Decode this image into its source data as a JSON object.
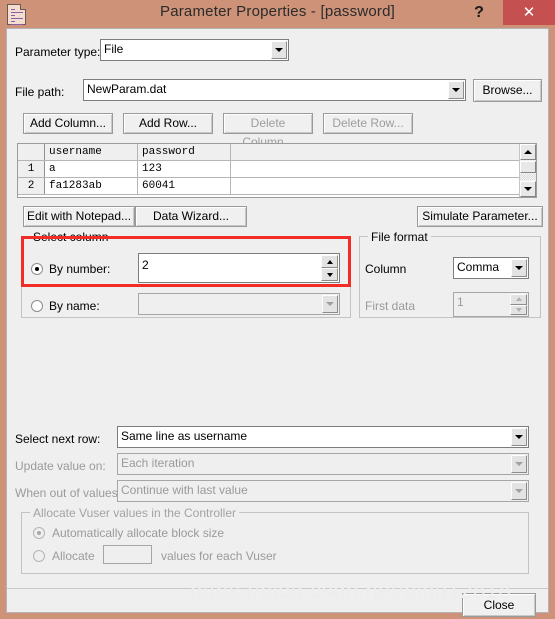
{
  "window": {
    "title": "Parameter Properties - [password]",
    "icon": "parameter-list-icon",
    "help_label": "?",
    "close_label": "✕",
    "titlebar_color": "#cd9277",
    "close_color": "#c4514f",
    "highlight_color": "#f22c26"
  },
  "parameter_type": {
    "label": "Parameter type:",
    "value": "File"
  },
  "file_path": {
    "label": "File path:",
    "value": "NewParam.dat",
    "browse_label": "Browse..."
  },
  "table_buttons": {
    "add_column": "Add Column...",
    "add_row": "Add Row...",
    "delete_column": "Delete Column...",
    "delete_row": "Delete Row..."
  },
  "grid": {
    "columns": [
      "",
      "username",
      "password",
      ""
    ],
    "rows": [
      {
        "num": "1",
        "username": "a",
        "password": "123"
      },
      {
        "num": "2",
        "username": "fa1283ab",
        "password": "60041"
      }
    ]
  },
  "tool_buttons": {
    "edit_with_notepad": "Edit with Notepad...",
    "data_wizard": "Data Wizard...",
    "simulate_parameter": "Simulate Parameter..."
  },
  "select_column": {
    "caption": "Select column",
    "by_number_label": "By number:",
    "by_number_value": "2",
    "by_number_selected": true,
    "by_name_label": "By name:",
    "by_name_value": "",
    "by_name_selected": false
  },
  "file_format": {
    "caption": "File format",
    "column_label": "Column",
    "column_value": "Comma",
    "first_data_label": "First data",
    "first_data_value": "1"
  },
  "rows_section": {
    "select_next_row_label": "Select next row:",
    "select_next_row_value": "Same line as username",
    "update_value_on_label": "Update value on:",
    "update_value_on_value": "Each iteration",
    "when_out_of_values_label": "When out of values:",
    "when_out_of_values_value": "Continue with last value"
  },
  "allocate": {
    "caption": "Allocate Vuser values in the Controller",
    "auto_label": "Automatically allocate block size",
    "auto_selected": true,
    "allocate_label": "Allocate",
    "allocate_value": "",
    "allocate_suffix": "values for each Vuser",
    "allocate_selected": false
  },
  "footer": {
    "close_label": "Close",
    "watermark": "https://blog.csdn.net/bihu12818"
  }
}
